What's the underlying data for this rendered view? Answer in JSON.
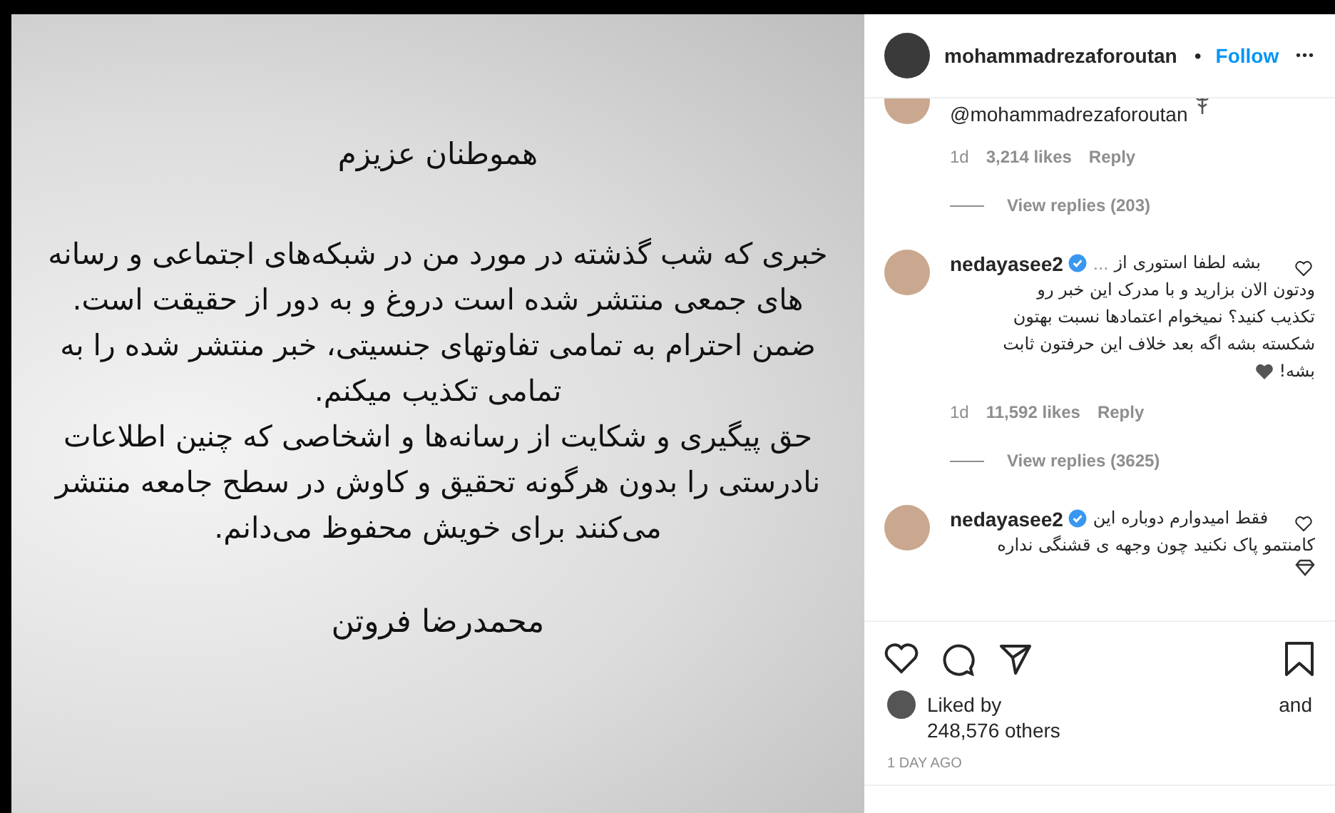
{
  "post_image": {
    "heading": "هموطنان عزیزم",
    "lines": [
      "خبری که شب گذشته در مورد من در شبکه‌های اجتماعی و رسانه",
      "های جمعی منتشر شده است دروغ و به دور از حقیقت است.",
      "ضمن احترام به تمامی تفاوتهای جنسیتی، خبر منتشر شده را به",
      "تمامی تکذیب میکنم.",
      "حق پیگیری و شکایت از رسانه‌ها و اشخاصی که چنین اطلاعات",
      "نادرستی را بدون هرگونه تحقیق و کاوش در سطح جامعه منتشر",
      "می‌کنند برای خویش محفوظ می‌دانم."
    ],
    "signature": "محمدرضا فروتن"
  },
  "header": {
    "username": "mohammadrezaforoutan",
    "separator": "•",
    "follow": "Follow",
    "more": "•••"
  },
  "comments": [
    {
      "verified": false,
      "lines": [
        "@mohammadrezaforoutan"
      ],
      "trailing_icon": {
        "kind": "flower"
      },
      "time": "1d",
      "likes": "3,214 likes",
      "reply": "Reply",
      "replies": "View replies (203)",
      "like_button": false
    },
    {
      "username": "nedayasee2",
      "verified": true,
      "truncation_mark": "...",
      "lines": [
        "بشه لطفا استوری از",
        "ودتون الان بزارید و با مدرک این خبر رو",
        "تکذیب کنید؟ نمیخوام اعتمادها نسبت بهتون",
        "شکسته بشه اگه بعد خلاف این حرفتون ثابت",
        "بشه!"
      ],
      "trailing_icon": {
        "kind": "heart"
      },
      "time": "1d",
      "likes": "11,592 likes",
      "reply": "Reply",
      "replies": "View replies (3625)",
      "like_button": true
    },
    {
      "username": "nedayasee2",
      "verified": true,
      "lines": [
        "فقط امیدوارم دوباره این",
        "کامنتمو پاک نکنید چون وجهه ی قشنگی نداره"
      ],
      "trailing_icon": {
        "kind": "diamond"
      },
      "like_button": true
    }
  ],
  "likes": {
    "prefix": "Liked by",
    "joiner": "and",
    "count": "248,576 others"
  },
  "date": "1 DAY AGO"
}
